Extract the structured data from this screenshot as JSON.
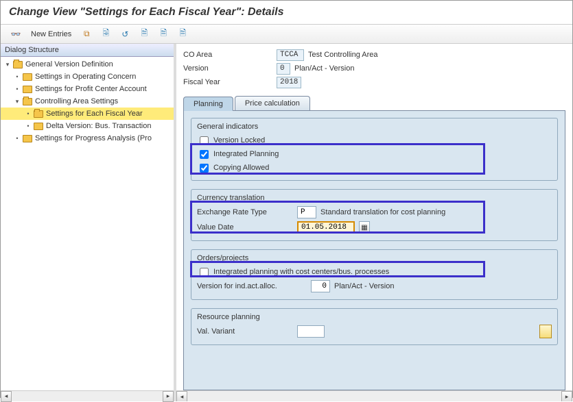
{
  "title": "Change View \"Settings for Each Fiscal Year\": Details",
  "toolbar": {
    "new_entries": "New Entries"
  },
  "dialog_structure_label": "Dialog Structure",
  "tree": {
    "n0": "General Version Definition",
    "n1": "Settings in Operating Concern",
    "n2": "Settings for Profit Center Account",
    "n3": "Controlling Area Settings",
    "n4": "Settings for Each Fiscal Year",
    "n5": "Delta Version: Bus. Transaction",
    "n6": "Settings for Progress Analysis (Pro"
  },
  "header": {
    "co_area_label": "CO Area",
    "co_area_value": "TCCA",
    "co_area_desc": "Test Controlling Area",
    "version_label": "Version",
    "version_value": "0",
    "version_desc": "Plan/Act - Version",
    "fy_label": "Fiscal Year",
    "fy_value": "2018"
  },
  "tabs": {
    "planning": "Planning",
    "price_calc": "Price calculation"
  },
  "groups": {
    "general_indicators": "General indicators",
    "version_locked": "Version Locked",
    "integrated_planning": "Integrated Planning",
    "copying_allowed": "Copying Allowed",
    "currency_translation": "Currency translation",
    "ex_rate_type_label": "Exchange Rate Type",
    "ex_rate_type_value": "P",
    "ex_rate_type_desc": "Standard translation for cost planning",
    "value_date_label": "Value Date",
    "value_date_value": "01.05.2018",
    "orders_projects": "Orders/projects",
    "integrated_cc": "Integrated planning with cost centers/bus. processes",
    "version_ind_label": "Version for ind.act.alloc.",
    "version_ind_value": "0",
    "version_ind_desc": "Plan/Act - Version",
    "resource_planning": "Resource planning",
    "val_variant_label": "Val. Variant",
    "val_variant_value": ""
  }
}
